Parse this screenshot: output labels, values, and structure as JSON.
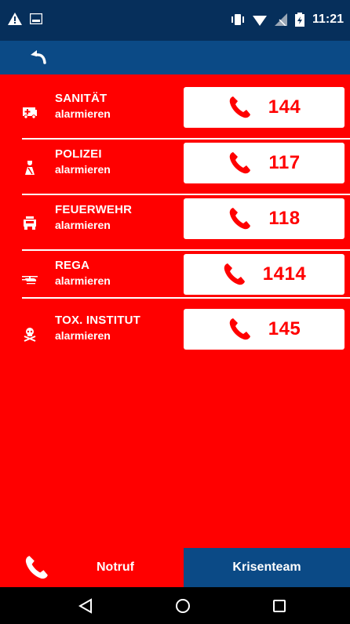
{
  "status_bar": {
    "time": "11:21"
  },
  "services": [
    {
      "name": "SANITÄT",
      "action": "alarmieren",
      "number": "144",
      "icon": "ambulance-icon"
    },
    {
      "name": "POLIZEI",
      "action": "alarmieren",
      "number": "117",
      "icon": "police-icon"
    },
    {
      "name": "FEUERWEHR",
      "action": "alarmieren",
      "number": "118",
      "icon": "fire-truck-icon"
    },
    {
      "name": "REGA",
      "action": "alarmieren",
      "number": "1414",
      "icon": "helicopter-icon"
    },
    {
      "name": "TOX. INSTITUT",
      "action": "alarmieren",
      "number": "145",
      "icon": "skull-icon"
    }
  ],
  "tabs": {
    "notruf": "Notruf",
    "krisenteam": "Krisenteam"
  },
  "colors": {
    "primary_red": "#ff0000",
    "dark_blue": "#0b4a86",
    "status_blue": "#062f5b",
    "white": "#ffffff"
  }
}
